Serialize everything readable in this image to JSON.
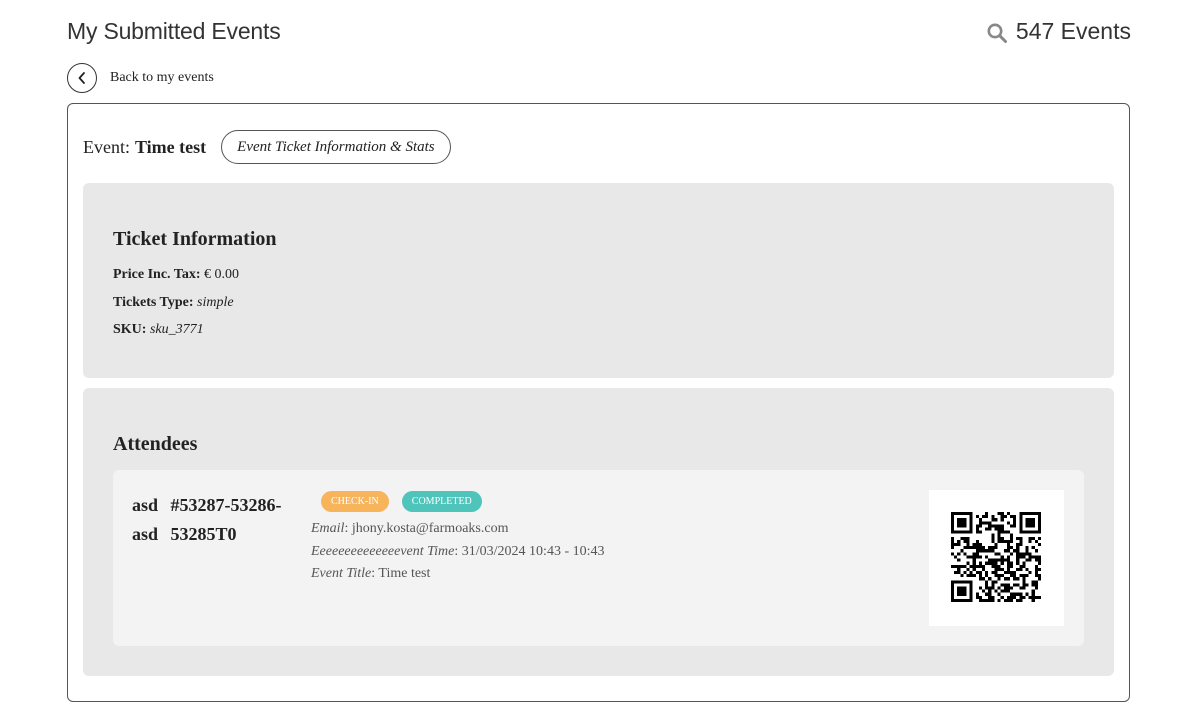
{
  "header": {
    "title": "My Submitted Events",
    "events_count": "547 Events",
    "search_icon": "search-icon"
  },
  "back": {
    "label": "Back to my events",
    "icon": "chevron-left-icon"
  },
  "event": {
    "prefix": "Event:",
    "name": "Time test",
    "stats_button": "Event Ticket Information & Stats"
  },
  "ticket_info": {
    "heading": "Ticket Information",
    "price_label": "Price Inc. Tax:",
    "price_value": "€ 0.00",
    "type_label": "Tickets Type:",
    "type_value": "simple",
    "sku_label": "SKU:",
    "sku_value": "sku_3771"
  },
  "attendees": {
    "heading": "Attendees",
    "items": [
      {
        "name_line1": "asd #53287-53286-",
        "name_line2": "asd 53285T0",
        "badges": [
          "CHECK-IN",
          "COMPLETED"
        ],
        "email_label": "Email",
        "email_value": ": jhony.kosta@farmoaks.com",
        "time_label": "Eeeeeeeeeeeeeevent Time",
        "time_value": ": 31/03/2024 10:43 - 10:43",
        "title_label": "Event Title",
        "title_value": ": Time test"
      }
    ]
  },
  "colors": {
    "checkin": "#f7b45a",
    "completed": "#4fc4bb",
    "panel": "#e8e8e8",
    "card": "#f3f3f3"
  }
}
